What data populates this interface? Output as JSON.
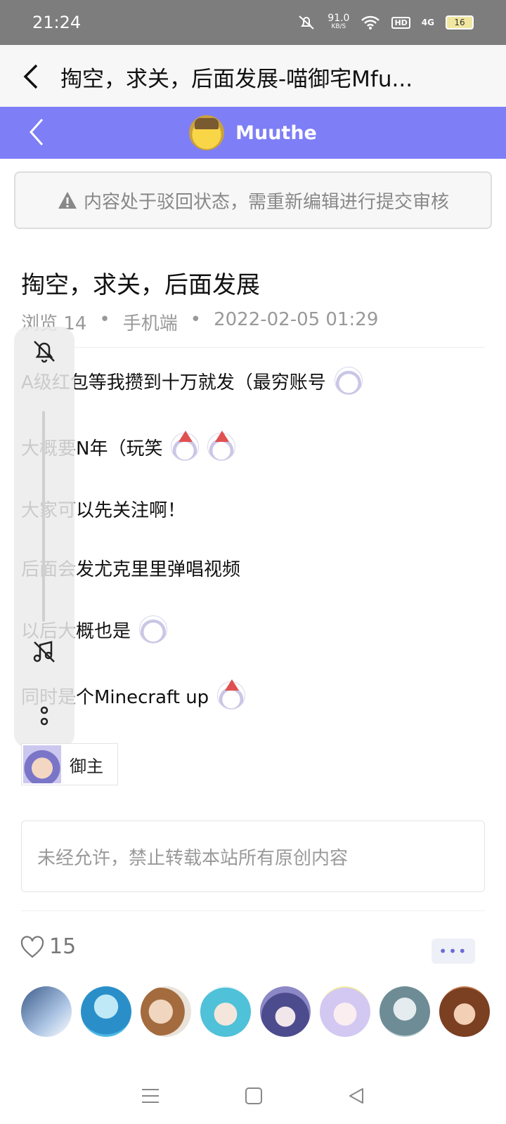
{
  "status_bar": {
    "time": "21:24",
    "net_speed": "91.0",
    "net_unit": "KB/S",
    "hd": "HD",
    "signal": "4G",
    "battery": "16"
  },
  "topbar": {
    "title": "掏空，求关，后面发展-喵御宅Mfu..."
  },
  "banner": {
    "username": "Muuthe"
  },
  "notice": {
    "text": "内容处于驳回状态，需重新编辑进行提交审核"
  },
  "post": {
    "title": "掏空，求关，后面发展",
    "views": "浏览 14",
    "client": "手机端",
    "date": "2022-02-05 01:29",
    "lines": [
      "A级红包等我攒到十万就发（最穷账号",
      "大概要N年（玩笑",
      "大家可以先关注啊！",
      "后面会发尤克里里弹唱视频",
      "以后大概也是",
      "同时是个Minecraft up"
    ],
    "tag_label": "御主",
    "copyright": "未经允许，禁止转载本站所有原创内容"
  },
  "likes": {
    "count": "15"
  },
  "colors": {
    "banner": "#7e7ef6",
    "status_bar": "#7d7d7d",
    "accent": "#6b6bd6"
  },
  "icons": [
    "back-icon",
    "warning-icon",
    "mute-bell-icon",
    "music-off-icon",
    "more-dots-icon",
    "heart-icon",
    "menu-icon",
    "home-square-icon",
    "back-triangle-icon"
  ]
}
